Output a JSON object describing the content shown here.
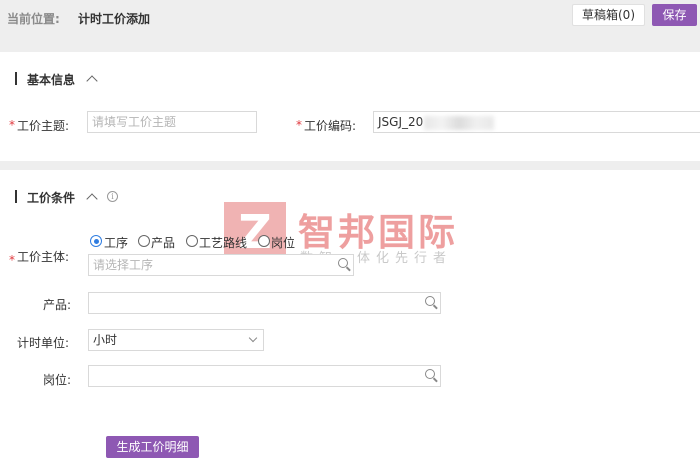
{
  "header": {
    "location_label": "当前位置:",
    "location_current": "计时工价添加",
    "draft_button": "草稿箱(0)",
    "save_button": "保存"
  },
  "basic_info": {
    "title": "基本信息",
    "subject_label": "工价主题:",
    "subject_placeholder": "请填写工价主题",
    "code_label": "工价编码:",
    "code_value": "JSGJ_20"
  },
  "conditions": {
    "title": "工价条件",
    "entity_label": "工价主体:",
    "entity_options": [
      "工序",
      "产品",
      "工艺路线",
      "岗位"
    ],
    "entity_selected": "工序",
    "entity_placeholder": "请选择工序",
    "product_label": "产品:",
    "unit_label": "计时单位:",
    "unit_value": "小时",
    "position_label": "岗位:",
    "generate_button": "生成工价明细"
  },
  "watermark": {
    "logo_letter": "Z",
    "title": "智邦国际",
    "subtitle": "数智一体化先行者"
  },
  "colors": {
    "accent": "#8e58b3",
    "required": "#e0393e",
    "radio_selected": "#2f7de1"
  },
  "icons": [
    "chevron-up-icon",
    "info-icon",
    "search-icon",
    "chevron-down-icon"
  ]
}
